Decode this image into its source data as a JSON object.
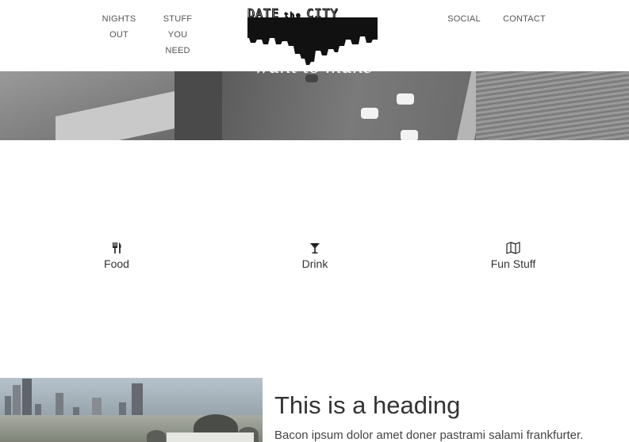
{
  "nav": {
    "left": [
      {
        "lines": [
          "NIGHTS",
          "OUT"
        ]
      },
      {
        "lines": [
          "STUFF",
          "YOU",
          "NEED"
        ]
      }
    ],
    "right": [
      {
        "lines": [
          "SOCIAL"
        ]
      },
      {
        "lines": [
          "CONTACT"
        ]
      }
    ],
    "logo": {
      "word1": "DATE",
      "word2": "the",
      "word3": "CITY"
    }
  },
  "hero": {
    "caption": "want to make"
  },
  "categories": [
    {
      "label": "Food",
      "icon": "cutlery-icon"
    },
    {
      "label": "Drink",
      "icon": "cocktail-icon"
    },
    {
      "label": "Fun Stuff",
      "icon": "map-icon"
    }
  ],
  "feature": {
    "heading": "This is a heading",
    "text": "Bacon ipsum dolor amet doner pastrami salami frankfurter."
  },
  "colors": {
    "text": "#333333",
    "nav_text": "#555555",
    "background": "#ffffff"
  }
}
